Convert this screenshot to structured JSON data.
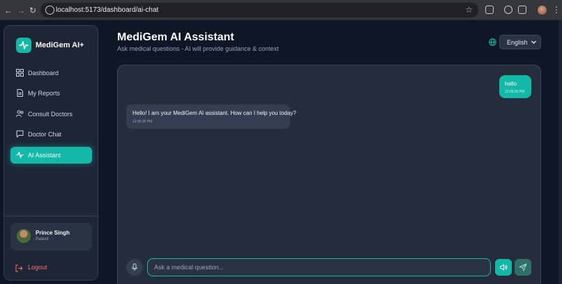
{
  "browser": {
    "url": "localhost:5173/dashboard/ai-chat"
  },
  "sidebar": {
    "brand": "MediGem AI+",
    "items": [
      {
        "label": "Dashboard",
        "icon": "grid-icon"
      },
      {
        "label": "My Reports",
        "icon": "document-icon"
      },
      {
        "label": "Consult Doctors",
        "icon": "users-icon"
      },
      {
        "label": "Doctor Chat",
        "icon": "message-icon"
      },
      {
        "label": "AI Assistant",
        "icon": "activity-icon",
        "active": true
      }
    ],
    "user": {
      "name": "Prince Singh",
      "role": "Patient"
    },
    "logout_label": "Logout"
  },
  "header": {
    "title": "MediGem AI Assistant",
    "subtitle": "Ask medical questions - AI will provide guidance & context",
    "language": "English"
  },
  "chat": {
    "messages": [
      {
        "sender": "user",
        "text": "hello",
        "time": "12:06:35 PM"
      },
      {
        "sender": "assistant",
        "text": "Hello! I am your MediGem AI assistant. How can I help you today?",
        "time": "12:06:35 PM"
      }
    ],
    "input_placeholder": "Ask a medical question..."
  },
  "colors": {
    "accent": "#14b8a6",
    "background": "#0f1726",
    "panel": "#252d3d",
    "logout": "#f87171"
  }
}
